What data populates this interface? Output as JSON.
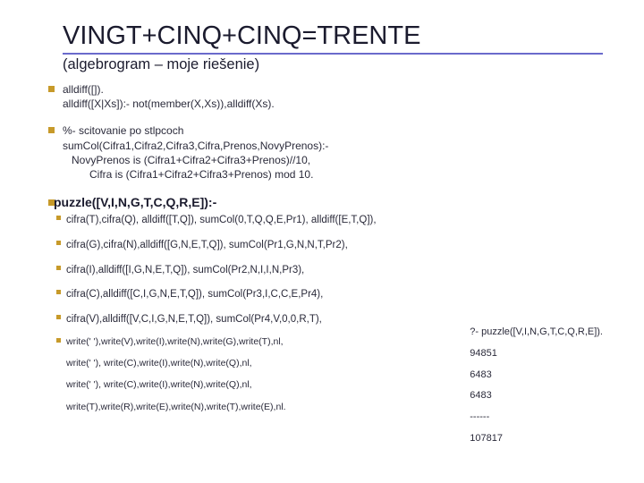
{
  "title": "VINGT+CINQ+CINQ=TRENTE",
  "subtitle": "(algebrogram – moje riešenie)",
  "blocks": {
    "alldiff": "alldiff([]).\nalldiff([X|Xs]):- not(member(X,Xs)),alldiff(Xs).",
    "scitovanie": "%- scitovanie po stlpcoch\nsumCol(Cifra1,Cifra2,Cifra3,Cifra,Prenos,NovyPrenos):-\n   NovyPrenos is (Cifra1+Cifra2+Cifra3+Prenos)//10,\n         Cifra is (Cifra1+Cifra2+Cifra3+Prenos) mod 10."
  },
  "puzzle_head": "puzzle([V,I,N,G,T,C,Q,R,E]):-",
  "puzzle_body": [
    "cifra(T),cifra(Q), alldiff([T,Q]),  sumCol(0,T,Q,Q,E,Pr1), alldiff([E,T,Q]),",
    "cifra(G),cifra(N),alldiff([G,N,E,T,Q]),  sumCol(Pr1,G,N,N,T,Pr2),",
    "cifra(I),alldiff([I,G,N,E,T,Q]), sumCol(Pr2,N,I,I,N,Pr3),",
    "cifra(C),alldiff([C,I,G,N,E,T,Q]),  sumCol(Pr3,I,C,C,E,Pr4),",
    "cifra(V),alldiff([V,C,I,G,N,E,T,Q]),  sumCol(Pr4,V,0,0,R,T),"
  ],
  "writes": [
    "write(' '),write(V),write(I),write(N),write(G),write(T),nl,",
    "write('  '),        write(C),write(I),write(N),write(Q),nl,",
    "write('  '),        write(C),write(I),write(N),write(Q),nl,",
    "write(T),write(R),write(E),write(N),write(T),write(E),nl."
  ],
  "output": {
    "query": "?- puzzle([V,I,N,G,T,C,Q,R,E]).",
    "lines": [
      " 94851",
      "  6483",
      "  6483",
      "------",
      "107817"
    ]
  }
}
